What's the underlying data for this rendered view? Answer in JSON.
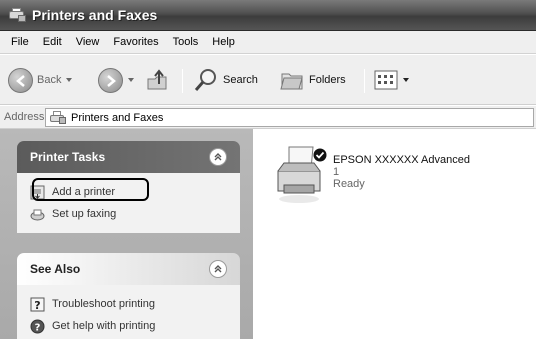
{
  "window": {
    "title": "Printers and Faxes"
  },
  "menu": [
    "File",
    "Edit",
    "View",
    "Favorites",
    "Tools",
    "Help"
  ],
  "toolbar": {
    "back": "Back",
    "search": "Search",
    "folders": "Folders"
  },
  "address": {
    "label": "Address",
    "value": "Printers and Faxes"
  },
  "printer_tasks": {
    "title": "Printer Tasks",
    "items": [
      "Add a printer",
      "Set up faxing"
    ]
  },
  "see_also": {
    "title": "See Also",
    "items": [
      "Troubleshoot printing",
      "Get help with printing"
    ]
  },
  "printer": {
    "name": "EPSON XXXXXX  Advanced",
    "count": "1",
    "status": "Ready"
  },
  "icons": [
    "printer-icon",
    "back-arrow-icon",
    "forward-arrow-icon",
    "up-folder-icon",
    "search-icon",
    "folders-icon",
    "views-icon",
    "add-printer-icon",
    "fax-icon",
    "help-icon",
    "default-check-icon",
    "collapse-chevron-icon"
  ]
}
